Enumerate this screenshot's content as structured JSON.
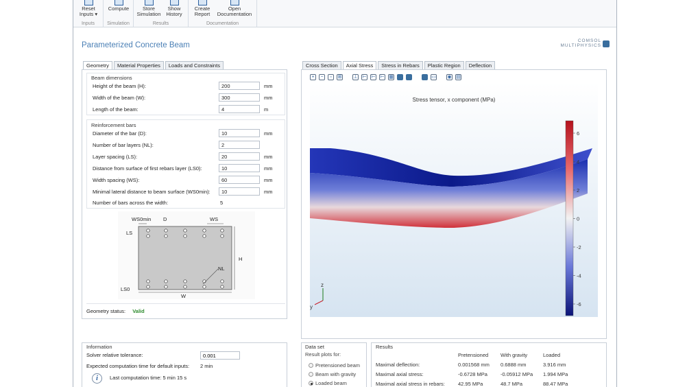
{
  "ribbon": {
    "groups": [
      {
        "label": "Inputs",
        "buttons": [
          {
            "label": "Reset Inputs ▾",
            "icon": "reset-icon"
          }
        ]
      },
      {
        "label": "Simulation",
        "buttons": [
          {
            "label": "Compute",
            "icon": "compute-icon"
          }
        ]
      },
      {
        "label": "Results",
        "buttons": [
          {
            "label": "Store Simulation",
            "icon": "store-icon"
          },
          {
            "label": "Show History",
            "icon": "history-icon"
          }
        ]
      },
      {
        "label": "Documentation",
        "buttons": [
          {
            "label": "Create Report",
            "icon": "report-icon"
          },
          {
            "label": "Open Documentation",
            "icon": "documentation-icon"
          }
        ]
      }
    ]
  },
  "app": {
    "title": "Parameterized Concrete Beam",
    "logo": "COMSOL MULTIPHYSICS"
  },
  "left_tabs": [
    "Geometry",
    "Material Properties",
    "Loads and Constraints"
  ],
  "beam_dimensions": {
    "heading": "Beam dimensions",
    "rows": [
      {
        "label": "Height of the beam (H):",
        "value": "200",
        "unit": "mm"
      },
      {
        "label": "Width of the beam (W):",
        "value": "300",
        "unit": "mm"
      },
      {
        "label": "Length of the beam:",
        "value": "4",
        "unit": "m"
      }
    ]
  },
  "reinforcement": {
    "heading": "Reinforcement bars",
    "rows": [
      {
        "label": "Diameter of the bar (D):",
        "value": "10",
        "unit": "mm"
      },
      {
        "label": "Number of bar layers (NL):",
        "value": "2",
        "unit": ""
      },
      {
        "label": "Layer spacing (LS):",
        "value": "20",
        "unit": "mm"
      },
      {
        "label": "Distance from surface of first rebars layer (LS0):",
        "value": "10",
        "unit": "mm"
      },
      {
        "label": "Width spacing (WS):",
        "value": "60",
        "unit": "mm"
      },
      {
        "label": "Minimal lateral distance to beam surface (WS0min):",
        "value": "10",
        "unit": "mm"
      }
    ],
    "count_label": "Number of bars across the width:",
    "count_value": "5"
  },
  "diagram_labels": {
    "ws0min": "WS0min",
    "d": "D",
    "ws": "WS",
    "ls": "LS",
    "h": "H",
    "nl": "NL",
    "ls0": "LS0",
    "w": "W"
  },
  "geometry_status": {
    "label": "Geometry status:",
    "value": "Valid",
    "color": "#2e8b2e"
  },
  "right_tabs": [
    "Cross Section",
    "Axial Stress",
    "Stress in Rebars",
    "Plastic Region",
    "Deflection"
  ],
  "plot": {
    "title": "Stress tensor, x component (MPa)",
    "colorbar_ticks": [
      "6",
      "4",
      "2",
      "0",
      "-2",
      "-4",
      "-6"
    ],
    "axis_z": "z",
    "axis_y": "y"
  },
  "information": {
    "heading": "Information",
    "tolerance_label": "Solver relative tolerance:",
    "tolerance_value": "0.001",
    "expected_label": "Expected computation time for default inputs:",
    "expected_value": "2 min",
    "last_label": "Last computation time: 5 min 15 s"
  },
  "dataset": {
    "heading": "Data set",
    "sub": "Result plots for:",
    "options": [
      {
        "label": "Pretensioned beam",
        "selected": false
      },
      {
        "label": "Beam with gravity",
        "selected": false
      },
      {
        "label": "Loaded beam",
        "selected": true
      }
    ]
  },
  "results": {
    "heading": "Results",
    "columns": [
      "Pretensioned",
      "With gravity",
      "Loaded"
    ],
    "rows": [
      {
        "label": "Maximal deflection:",
        "values": [
          "0.001568 mm",
          "0.6888 mm",
          "3.916 mm"
        ]
      },
      {
        "label": "Maximal axial stress:",
        "values": [
          "-0.6728 MPa",
          "-0.05912 MPa",
          "1.994 MPa"
        ]
      },
      {
        "label": "Maximal axial stress in rebars:",
        "values": [
          "42.95 MPa",
          "48.7 MPa",
          "88.47 MPa"
        ]
      }
    ]
  },
  "colors": {
    "accent": "#4a7fb5",
    "stress_high": "#c81e2a",
    "stress_low": "#1a2fb0"
  }
}
